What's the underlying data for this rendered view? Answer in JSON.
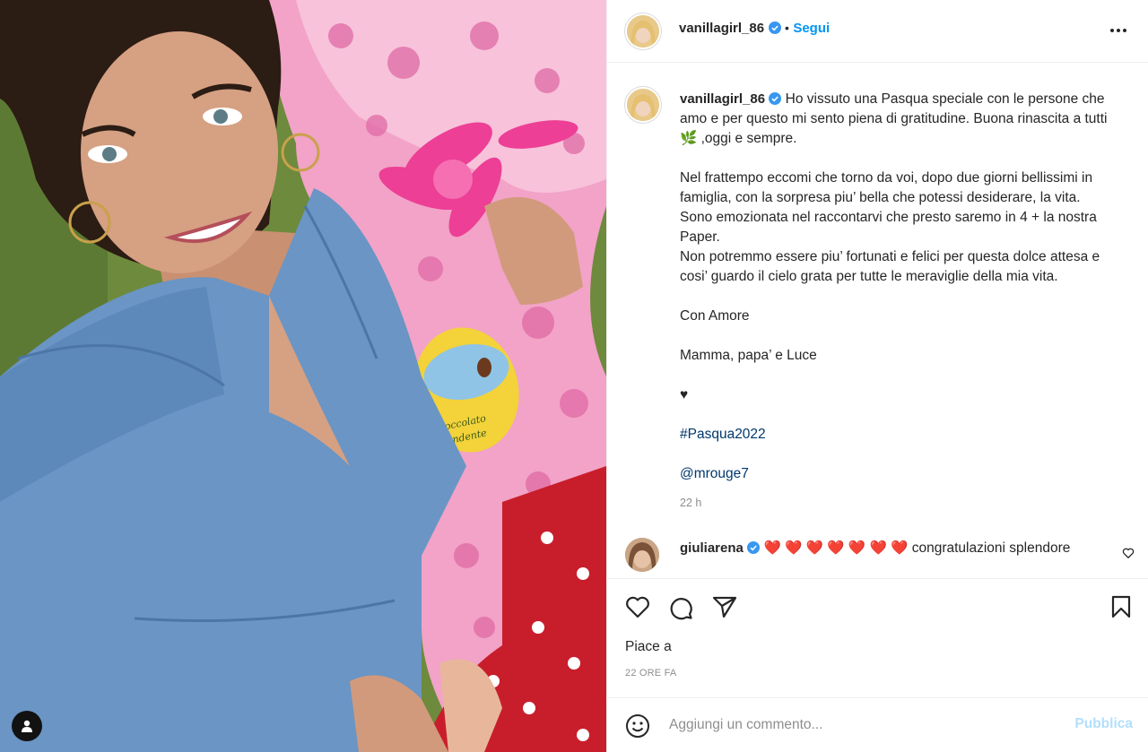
{
  "post": {
    "author": "vanillagirl_86",
    "separator": "•",
    "follow_label": "Segui",
    "caption_intro": " Ho vissuto una Pasqua speciale con le persone che amo e per questo mi sento piena di gratitudine. Buona rinascita a tutti 🌿 ,oggi e sempre.",
    "caption_lines": [
      "Nel frattempo eccomi che torno da voi, dopo due giorni bellissimi in famiglia, con la sorpresa piu’ bella che potessi desiderare, la vita.",
      "Sono emozionata nel raccontarvi che presto saremo in 4 + la nostra Paper.",
      "Non potremmo essere piu’ fortunati e felici per questa dolce attesa e cosi’ guardo il cielo grata per tutte le meraviglie della mia vita."
    ],
    "closing": "Con Amore",
    "signature": "Mamma, papa’ e Luce",
    "heart_symbol": "♥",
    "hashtag": "#Pasqua2022",
    "mention": "@mrouge7",
    "time_ago": "22 h"
  },
  "photo_label": {
    "line1": "Cioccolato",
    "line2": "Fondente"
  },
  "comment": {
    "author": "giuliarena",
    "text": "❤️ ❤️ ❤️ ❤️ ❤️ ❤️ ❤️ congratulazioni splendore"
  },
  "footer": {
    "likes_label": "Piace a",
    "date": "22 ORE FA",
    "comment_placeholder": "Aggiungi un commento...",
    "publish_label": "Pubblica"
  },
  "colors": {
    "accent": "#0095f6",
    "publish_disabled": "#b2dffc",
    "link": "#00376b",
    "muted": "#8e8e8e",
    "heart_red": "#ed4956"
  },
  "icons": [
    "user-icon",
    "verified-icon",
    "more-icon",
    "heart-icon",
    "comment-icon",
    "share-icon",
    "bookmark-icon",
    "emoji-icon"
  ]
}
